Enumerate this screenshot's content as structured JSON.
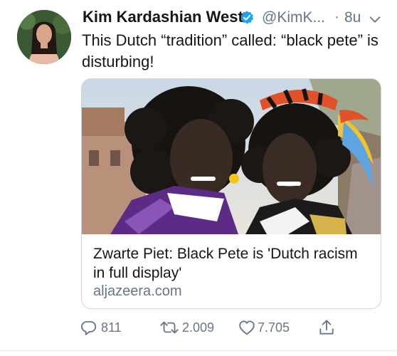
{
  "tweet": {
    "author_name": "Kim Kardashian West",
    "handle": "@KimK...",
    "separator": "·",
    "time": "8u",
    "text": "This Dutch “tradition” called: “black pete” is disturbing!"
  },
  "card": {
    "title": "Zwarte Piet: Black Pete is 'Dutch racism in full display'",
    "domain": "aljazeera.com"
  },
  "actions": {
    "replies": "811",
    "retweets": "2.009",
    "likes": "7.705"
  },
  "colors": {
    "verified": "#1da1f2",
    "secondary_text": "#657786",
    "border": "#ccd6dd"
  },
  "icons": [
    "verified-badge-icon",
    "chevron-down-icon",
    "reply-icon",
    "retweet-icon",
    "like-icon",
    "share-icon"
  ]
}
